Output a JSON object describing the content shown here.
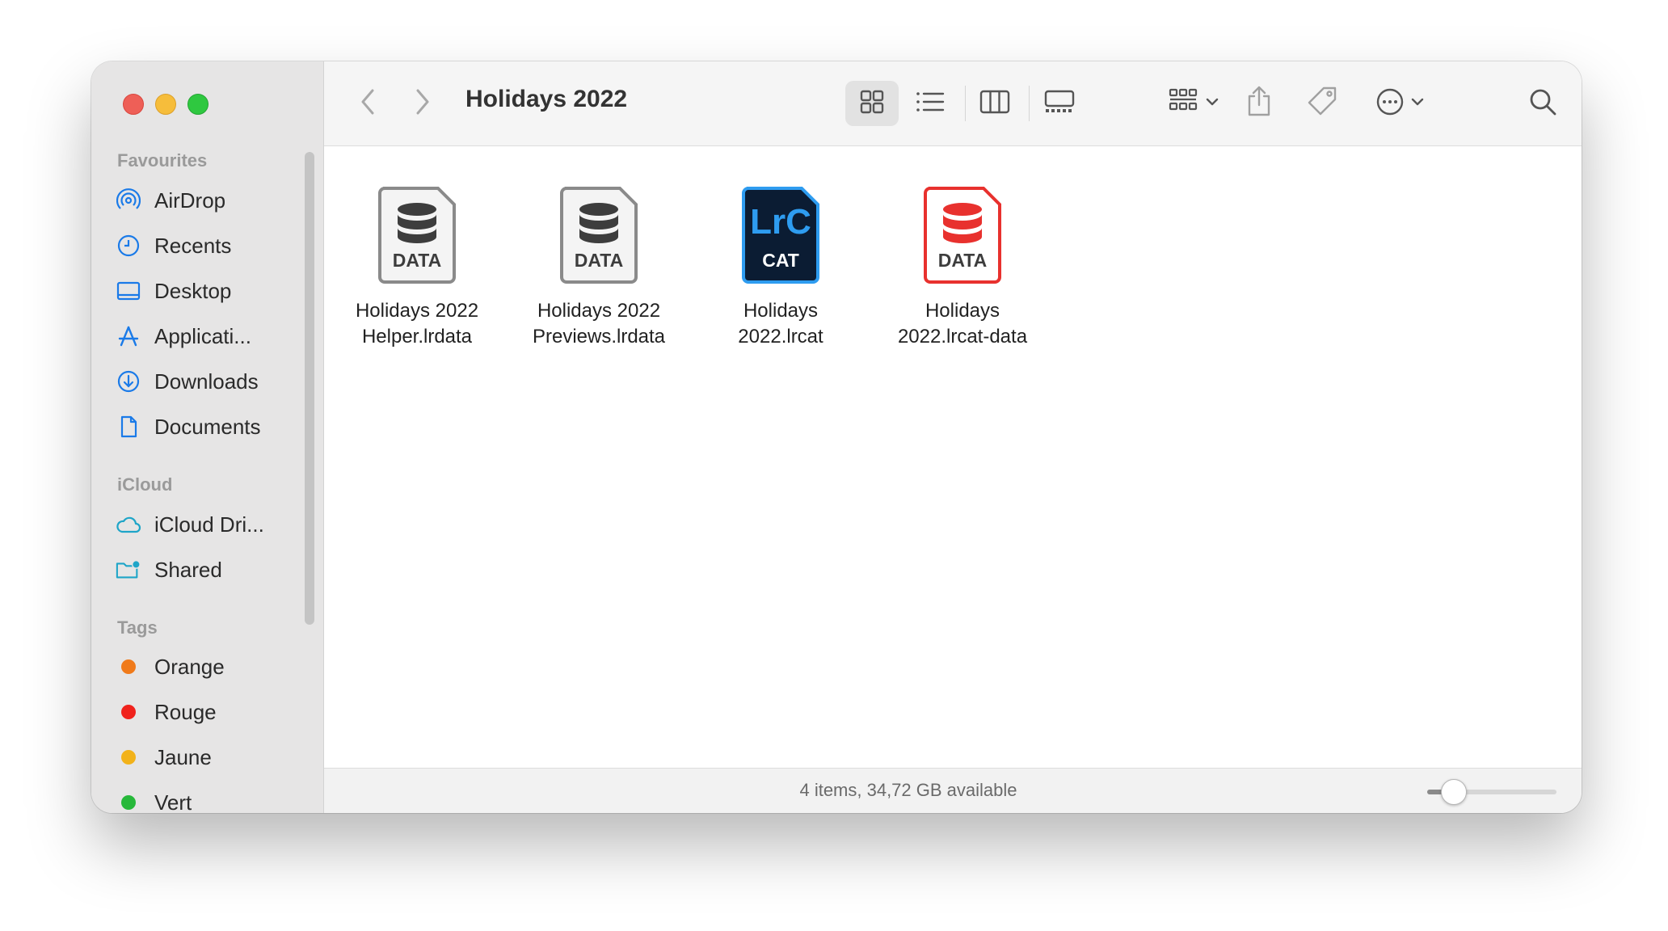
{
  "window": {
    "title": "Holidays 2022"
  },
  "sidebar": {
    "sections": [
      {
        "title": "Favourites",
        "items": [
          {
            "label": "AirDrop",
            "icon": "airdrop-icon"
          },
          {
            "label": "Recents",
            "icon": "clock-icon"
          },
          {
            "label": "Desktop",
            "icon": "desktop-icon"
          },
          {
            "label": "Applicati...",
            "icon": "applications-icon"
          },
          {
            "label": "Downloads",
            "icon": "download-icon"
          },
          {
            "label": "Documents",
            "icon": "document-icon"
          }
        ]
      },
      {
        "title": "iCloud",
        "items": [
          {
            "label": "iCloud Dri...",
            "icon": "cloud-icon"
          },
          {
            "label": "Shared",
            "icon": "shared-folder-icon"
          }
        ]
      },
      {
        "title": "Tags",
        "items": [
          {
            "label": "Orange",
            "color": "#f07a1a"
          },
          {
            "label": "Rouge",
            "color": "#f0221c"
          },
          {
            "label": "Jaune",
            "color": "#f2b21a"
          },
          {
            "label": "Vert",
            "color": "#27b83a"
          }
        ]
      }
    ]
  },
  "toolbar": {
    "back": "chevron-left-icon",
    "forward": "chevron-right-icon",
    "views": [
      "icon-view",
      "list-view",
      "column-view",
      "gallery-view"
    ],
    "selected_view": "icon-view"
  },
  "files": [
    {
      "line1": "Holidays 2022",
      "line2": "Helper.lrdata",
      "badge": "DATA",
      "style": "gray"
    },
    {
      "line1": "Holidays 2022",
      "line2": "Previews.lrdata",
      "badge": "DATA",
      "style": "gray"
    },
    {
      "line1": "Holidays",
      "line2": "2022.lrcat",
      "badge": "CAT",
      "logo": "LrC",
      "style": "lrc"
    },
    {
      "line1": "Holidays",
      "line2": "2022.lrcat-data",
      "badge": "DATA",
      "style": "red"
    }
  ],
  "status": {
    "text": "4 items, 34,72 GB available",
    "zoom": 0.2
  },
  "accent": "#1a7ae8"
}
